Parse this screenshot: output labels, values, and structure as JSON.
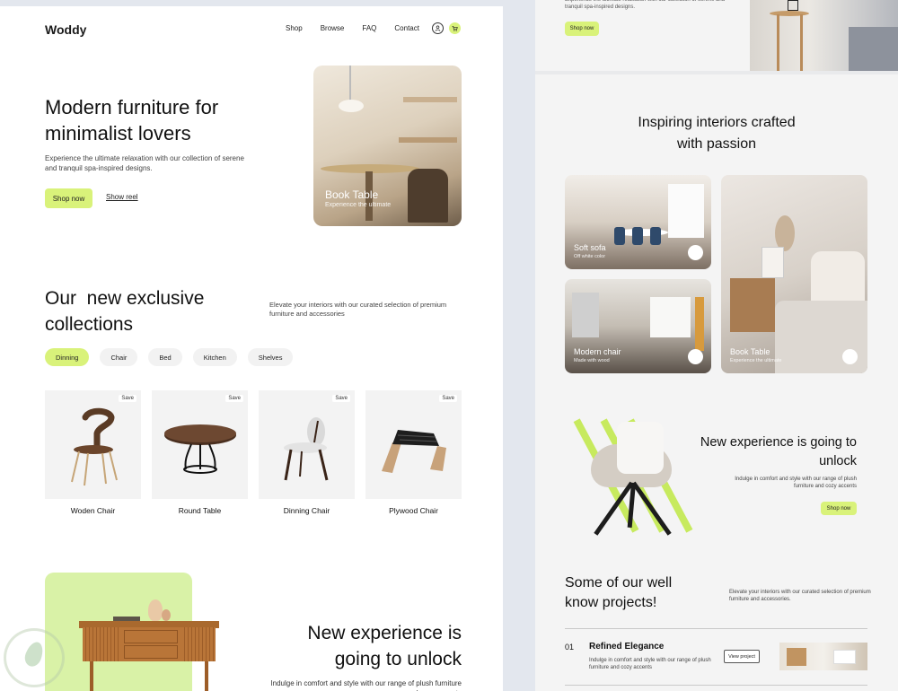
{
  "left": {
    "nav": {
      "logo": "Woddy",
      "links": [
        "Shop",
        "Browse",
        "FAQ",
        "Contact"
      ],
      "icons": [
        "user-icon",
        "cart-icon"
      ]
    },
    "hero": {
      "title": "Modern furniture for minimalist lovers",
      "description": "Experience the ultimate relaxation with our collection of serene and tranquil spa-inspired designs.",
      "shop_label": "Shop now",
      "reel_label": "Show reel",
      "image_title": "Book Table",
      "image_subtitle": "Experience the ultimate"
    },
    "collections": {
      "title": "Our  new exclusive collections",
      "description": "Elevate your interiors with our curated selection of premium furniture and accessories",
      "categories": [
        {
          "label": "Dinning",
          "active": true
        },
        {
          "label": "Chair",
          "active": false
        },
        {
          "label": "Bed",
          "active": false
        },
        {
          "label": "Kitchen",
          "active": false
        },
        {
          "label": "Shelves",
          "active": false
        }
      ],
      "products": [
        {
          "name": "Woden Chair",
          "save": "Save"
        },
        {
          "name": "Round Table",
          "save": "Save"
        },
        {
          "name": "Dinning Chair",
          "save": "Save"
        },
        {
          "name": "Plywood Chair",
          "save": "Save"
        }
      ]
    },
    "new_experience": {
      "title": "New experience is going to unlock",
      "description": "Indulge in comfort and style with our range of plush furniture and cozy accents"
    }
  },
  "right": {
    "top": {
      "description": "Experience the ultimate relaxation with our collection of serene and tranquil spa-inspired designs.",
      "shop_label": "Shop now"
    },
    "inspiring": {
      "title": "Inspiring interiors crafted with passion",
      "cards": [
        {
          "title": "Soft sofa",
          "subtitle": "Off white color"
        },
        {
          "title": "Modern chair",
          "subtitle": "Made with wood"
        },
        {
          "title": "Book Table",
          "subtitle": "Experience the ultimate"
        }
      ]
    },
    "new_experience": {
      "title": "New experience is going to unlock",
      "description": "Indulge in comfort and style with our range of plush furniture and cozy accents",
      "shop_label": "Shop now"
    },
    "projects": {
      "title": "Some of our well know projects!",
      "description": "Elevate your interiors with our curated selection of premium furniture and accessories.",
      "items": [
        {
          "number": "01",
          "name": "Refined Elegance",
          "text": "Indulge in comfort and style with our range of plush furniture and cozy accents",
          "button": "View project"
        }
      ]
    }
  },
  "colors": {
    "accent_green": "#d9f27a",
    "soft_green": "#d9f2a7",
    "stripe_green": "#c7ea5e",
    "text_dark": "#111111",
    "page_bg": "#e3e7ee"
  }
}
